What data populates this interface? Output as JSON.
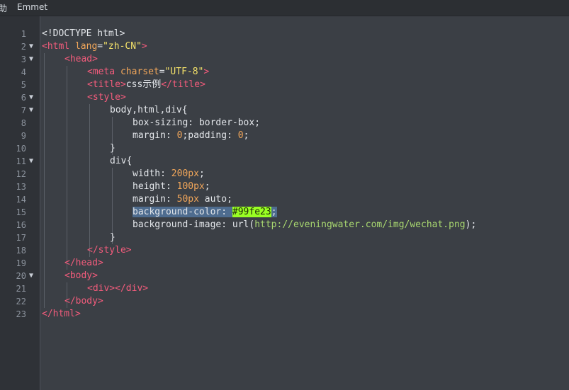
{
  "menubar": {
    "items": [
      "助",
      "Emmet"
    ]
  },
  "editor": {
    "lines": [
      {
        "n": "1",
        "fold": "",
        "indent": 0,
        "tokens": [
          {
            "t": "<!DOCTYPE html>",
            "c": "txt"
          }
        ]
      },
      {
        "n": "2",
        "fold": "▼",
        "indent": 0,
        "tokens": [
          {
            "t": "<html",
            "c": "tag"
          },
          {
            "t": " lang",
            "c": "attr"
          },
          {
            "t": "=",
            "c": "punc"
          },
          {
            "t": "\"zh-CN\"",
            "c": "str"
          },
          {
            "t": ">",
            "c": "tag"
          }
        ]
      },
      {
        "n": "3",
        "fold": "▼",
        "indent": 1,
        "tokens": [
          {
            "t": "<head>",
            "c": "tag"
          }
        ]
      },
      {
        "n": "4",
        "fold": "",
        "indent": 2,
        "tokens": [
          {
            "t": "<meta",
            "c": "tag"
          },
          {
            "t": " charset",
            "c": "attr"
          },
          {
            "t": "=",
            "c": "punc"
          },
          {
            "t": "\"UTF-8\"",
            "c": "str"
          },
          {
            "t": ">",
            "c": "tag"
          }
        ]
      },
      {
        "n": "5",
        "fold": "",
        "indent": 2,
        "tokens": [
          {
            "t": "<title>",
            "c": "tag"
          },
          {
            "t": "css示例",
            "c": "txt"
          },
          {
            "t": "</title>",
            "c": "tag"
          }
        ]
      },
      {
        "n": "6",
        "fold": "▼",
        "indent": 2,
        "tokens": [
          {
            "t": "<style>",
            "c": "tag"
          }
        ]
      },
      {
        "n": "7",
        "fold": "▼",
        "indent": 3,
        "tokens": [
          {
            "t": "body,html,div{",
            "c": "sel"
          }
        ]
      },
      {
        "n": "8",
        "fold": "",
        "indent": 4,
        "tokens": [
          {
            "t": "box-sizing",
            "c": "prop"
          },
          {
            "t": ": ",
            "c": "punc"
          },
          {
            "t": "border-box",
            "c": "txt"
          },
          {
            "t": ";",
            "c": "punc"
          }
        ]
      },
      {
        "n": "9",
        "fold": "",
        "indent": 4,
        "tokens": [
          {
            "t": "margin",
            "c": "prop"
          },
          {
            "t": ": ",
            "c": "punc"
          },
          {
            "t": "0",
            "c": "num"
          },
          {
            "t": ";",
            "c": "punc"
          },
          {
            "t": "padding",
            "c": "prop"
          },
          {
            "t": ": ",
            "c": "punc"
          },
          {
            "t": "0",
            "c": "num"
          },
          {
            "t": ";",
            "c": "punc"
          }
        ]
      },
      {
        "n": "10",
        "fold": "",
        "indent": 3,
        "tokens": [
          {
            "t": "}",
            "c": "punc"
          }
        ]
      },
      {
        "n": "11",
        "fold": "▼",
        "indent": 3,
        "tokens": [
          {
            "t": "div{",
            "c": "sel"
          }
        ]
      },
      {
        "n": "12",
        "fold": "",
        "indent": 4,
        "tokens": [
          {
            "t": "width",
            "c": "prop"
          },
          {
            "t": ": ",
            "c": "punc"
          },
          {
            "t": "200px",
            "c": "num"
          },
          {
            "t": ";",
            "c": "punc"
          }
        ]
      },
      {
        "n": "13",
        "fold": "",
        "indent": 4,
        "tokens": [
          {
            "t": "height",
            "c": "prop"
          },
          {
            "t": ": ",
            "c": "punc"
          },
          {
            "t": "100px",
            "c": "num"
          },
          {
            "t": ";",
            "c": "punc"
          }
        ]
      },
      {
        "n": "14",
        "fold": "",
        "indent": 4,
        "tokens": [
          {
            "t": "margin",
            "c": "prop"
          },
          {
            "t": ": ",
            "c": "punc"
          },
          {
            "t": "50px",
            "c": "num"
          },
          {
            "t": " auto",
            "c": "txt"
          },
          {
            "t": ";",
            "c": "punc"
          }
        ]
      },
      {
        "n": "15",
        "fold": "",
        "indent": 4,
        "tokens": [
          {
            "t": "background-color: ",
            "c": "prop",
            "h": "hl"
          },
          {
            "t": "#99fe23",
            "c": "txt",
            "h": "hl-color"
          },
          {
            "t": ";",
            "c": "punc",
            "h": "hl"
          }
        ]
      },
      {
        "n": "16",
        "fold": "",
        "indent": 4,
        "tokens": [
          {
            "t": "background-image",
            "c": "prop"
          },
          {
            "t": ": ",
            "c": "punc"
          },
          {
            "t": "url(",
            "c": "txt"
          },
          {
            "t": "http://eveningwater.com/img/wechat.png",
            "c": "url"
          },
          {
            "t": ");",
            "c": "txt"
          }
        ]
      },
      {
        "n": "17",
        "fold": "",
        "indent": 3,
        "tokens": [
          {
            "t": "}",
            "c": "punc"
          }
        ]
      },
      {
        "n": "18",
        "fold": "",
        "indent": 2,
        "tokens": [
          {
            "t": "</style>",
            "c": "tag"
          }
        ]
      },
      {
        "n": "19",
        "fold": "",
        "indent": 1,
        "tokens": [
          {
            "t": "</head>",
            "c": "tag"
          }
        ]
      },
      {
        "n": "20",
        "fold": "▼",
        "indent": 1,
        "tokens": [
          {
            "t": "<body>",
            "c": "tag"
          }
        ]
      },
      {
        "n": "21",
        "fold": "",
        "indent": 2,
        "tokens": [
          {
            "t": "<div></div>",
            "c": "tag"
          }
        ]
      },
      {
        "n": "22",
        "fold": "",
        "indent": 1,
        "tokens": [
          {
            "t": "</body>",
            "c": "tag"
          }
        ]
      },
      {
        "n": "23",
        "fold": "",
        "indent": 0,
        "tokens": [
          {
            "t": "</html>",
            "c": "tag"
          }
        ]
      }
    ]
  }
}
